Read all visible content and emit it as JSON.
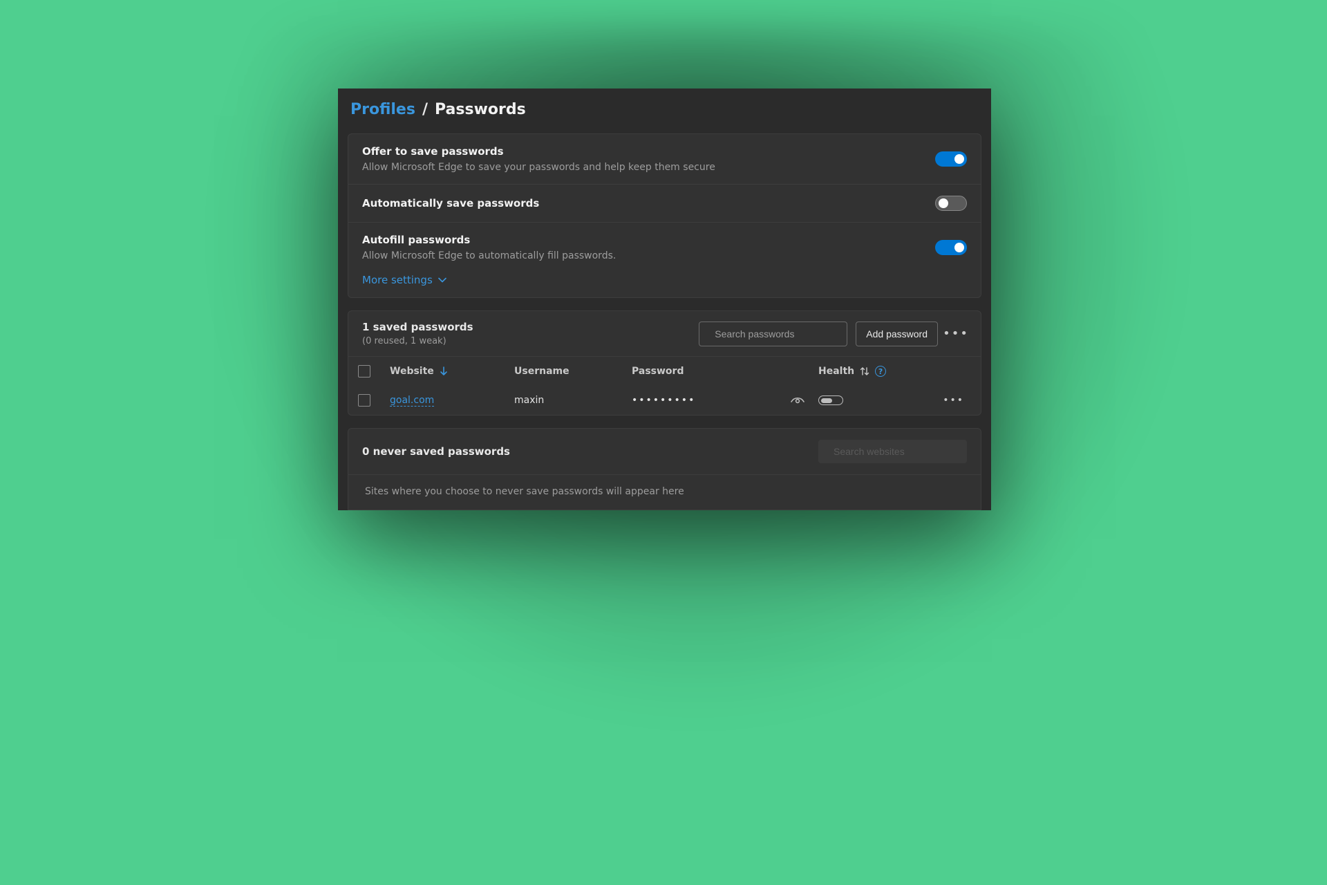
{
  "breadcrumb": {
    "root": "Profiles",
    "sep": "/",
    "current": "Passwords"
  },
  "settings": {
    "offer": {
      "title": "Offer to save passwords",
      "sub": "Allow Microsoft Edge to save your passwords and help keep them secure",
      "on": true
    },
    "auto_save": {
      "title": "Automatically save passwords",
      "on": false
    },
    "autofill": {
      "title": "Autofill passwords",
      "sub": "Allow Microsoft Edge to automatically fill passwords.",
      "on": true
    },
    "more_settings": "More settings"
  },
  "saved": {
    "count_label": "1 saved passwords",
    "substat": "(0 reused, 1 weak)",
    "search_placeholder": "Search passwords",
    "add_label": "Add password",
    "columns": {
      "website": "Website",
      "username": "Username",
      "password": "Password",
      "health": "Health"
    },
    "rows": [
      {
        "website": "goal.com",
        "username": "maxin",
        "password_mask": "•••••••••"
      }
    ]
  },
  "never": {
    "count_label": "0 never saved passwords",
    "search_placeholder": "Search websites",
    "desc": "Sites where you choose to never save passwords will appear here"
  }
}
